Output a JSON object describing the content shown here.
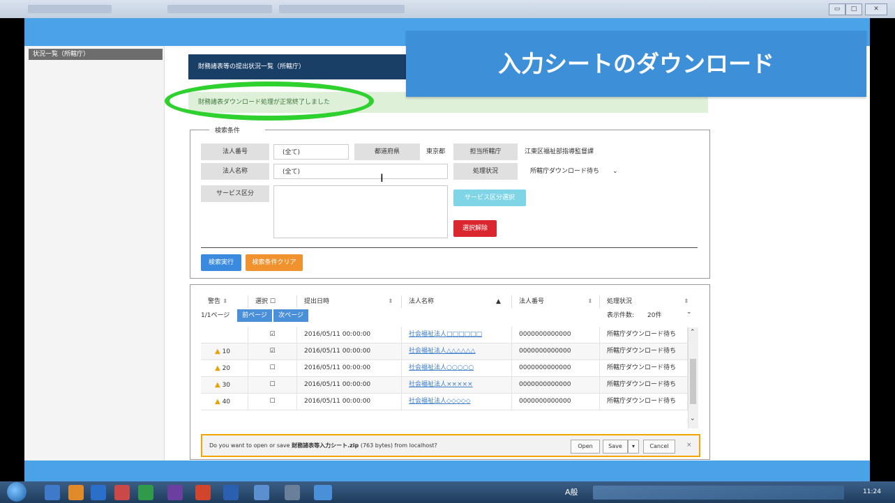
{
  "nav": {
    "item_label": "状況一覧（所轄庁）"
  },
  "panel": {
    "title": "財務諸表等の提出状況一覧（所轄庁）"
  },
  "alert": {
    "message": "財務諸表ダウンロード処理が正常終了しました"
  },
  "banner": {
    "text": "入力シートのダウンロード"
  },
  "search": {
    "legend": "検索条件",
    "corp_no_label": "法人番号",
    "corp_no_value": "(全て)",
    "pref_label": "都道府県",
    "pref_value": "東京都",
    "authority_label": "担当所轄庁",
    "authority_value": "江東区福祉部指導監督課",
    "corp_name_label": "法人名称",
    "corp_name_value": "(全て)",
    "status_label": "処理状況",
    "status_value": "所轄庁ダウンロード待ち",
    "service_label": "サービス区分",
    "service_select_button": "サービス区分選択",
    "clear_selection_button": "選択解除",
    "execute_button": "検索実行",
    "clear_conditions_button": "検索条件クリア"
  },
  "results": {
    "headers": [
      "警告",
      "選択",
      "提出日時",
      "法人名称",
      "法人番号",
      "処理状況"
    ],
    "page_info": "1/1ページ",
    "prev_page_button": "前ページ",
    "next_page_button": "次ページ",
    "per_page_label": "表示件数:",
    "per_page_value": "20件",
    "rows": [
      {
        "warning": "",
        "checked": "☑",
        "date": "2016/05/11 00:00:00",
        "name": "社会福祉法人□□□□□□",
        "corp_no": "0000000000000",
        "status": "所轄庁ダウンロード待ち"
      },
      {
        "warning": "10",
        "checked": "☑",
        "date": "2016/05/11 00:00:00",
        "name": "社会福祉法人△△△△△△",
        "corp_no": "0000000000000",
        "status": "所轄庁ダウンロード待ち"
      },
      {
        "warning": "20",
        "checked": "☐",
        "date": "2016/05/11 00:00:00",
        "name": "社会福祉法人○○○○○",
        "corp_no": "0000000000000",
        "status": "所轄庁ダウンロード待ち"
      },
      {
        "warning": "30",
        "checked": "☐",
        "date": "2016/05/11 00:00:00",
        "name": "社会福祉法人×××××",
        "corp_no": "0000000000000",
        "status": "所轄庁ダウンロード待ち"
      },
      {
        "warning": "40",
        "checked": "☐",
        "date": "2016/05/11 00:00:00",
        "name": "社会福祉法人◇◇◇◇◇",
        "corp_no": "0000000000000",
        "status": "所轄庁ダウンロード待ち"
      }
    ]
  },
  "download_bar": {
    "prefix": "Do you want to open or save ",
    "file_name": "財務諸表等入力シート.zip",
    "suffix": " (763 bytes) from localhost?",
    "open_button": "Open",
    "save_button": "Save",
    "cancel_button": "Cancel"
  },
  "taskbar": {
    "ime": "A般",
    "clock": "11:24"
  },
  "window": {
    "minimize": "▭",
    "maximize": "□",
    "close": "✕"
  }
}
